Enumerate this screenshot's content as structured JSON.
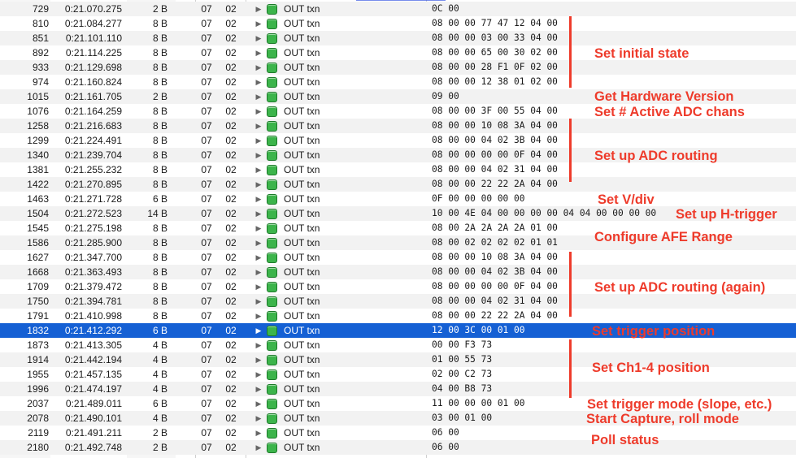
{
  "packets": [
    {
      "index": "729",
      "time": "0:21.070.275",
      "length": "2 B",
      "device": "07",
      "endpoint": "02",
      "description": "OUT txn",
      "data": "0C 00"
    },
    {
      "index": "810",
      "time": "0:21.084.277",
      "length": "8 B",
      "device": "07",
      "endpoint": "02",
      "description": "OUT txn",
      "data": "08 00 00 77 47 12 04 00"
    },
    {
      "index": "851",
      "time": "0:21.101.110",
      "length": "8 B",
      "device": "07",
      "endpoint": "02",
      "description": "OUT txn",
      "data": "08 00 00 03 00 33 04 00"
    },
    {
      "index": "892",
      "time": "0:21.114.225",
      "length": "8 B",
      "device": "07",
      "endpoint": "02",
      "description": "OUT txn",
      "data": "08 00 00 65 00 30 02 00"
    },
    {
      "index": "933",
      "time": "0:21.129.698",
      "length": "8 B",
      "device": "07",
      "endpoint": "02",
      "description": "OUT txn",
      "data": "08 00 00 28 F1 0F 02 00"
    },
    {
      "index": "974",
      "time": "0:21.160.824",
      "length": "8 B",
      "device": "07",
      "endpoint": "02",
      "description": "OUT txn",
      "data": "08 00 00 12 38 01 02 00"
    },
    {
      "index": "1015",
      "time": "0:21.161.705",
      "length": "2 B",
      "device": "07",
      "endpoint": "02",
      "description": "OUT txn",
      "data": "09 00"
    },
    {
      "index": "1076",
      "time": "0:21.164.259",
      "length": "8 B",
      "device": "07",
      "endpoint": "02",
      "description": "OUT txn",
      "data": "08 00 00 3F 00 55 04 00"
    },
    {
      "index": "1258",
      "time": "0:21.216.683",
      "length": "8 B",
      "device": "07",
      "endpoint": "02",
      "description": "OUT txn",
      "data": "08 00 00 10 08 3A 04 00"
    },
    {
      "index": "1299",
      "time": "0:21.224.491",
      "length": "8 B",
      "device": "07",
      "endpoint": "02",
      "description": "OUT txn",
      "data": "08 00 00 04 02 3B 04 00"
    },
    {
      "index": "1340",
      "time": "0:21.239.704",
      "length": "8 B",
      "device": "07",
      "endpoint": "02",
      "description": "OUT txn",
      "data": "08 00 00 00 00 0F 04 00"
    },
    {
      "index": "1381",
      "time": "0:21.255.232",
      "length": "8 B",
      "device": "07",
      "endpoint": "02",
      "description": "OUT txn",
      "data": "08 00 00 04 02 31 04 00"
    },
    {
      "index": "1422",
      "time": "0:21.270.895",
      "length": "8 B",
      "device": "07",
      "endpoint": "02",
      "description": "OUT txn",
      "data": "08 00 00 22 22 2A 04 00"
    },
    {
      "index": "1463",
      "time": "0:21.271.728",
      "length": "6 B",
      "device": "07",
      "endpoint": "02",
      "description": "OUT txn",
      "data": "0F 00 00 00 00 00"
    },
    {
      "index": "1504",
      "time": "0:21.272.523",
      "length": "14 B",
      "device": "07",
      "endpoint": "02",
      "description": "OUT txn",
      "data": "10 00 4E 04 00 00 00 00 04 04 00 00 00 00"
    },
    {
      "index": "1545",
      "time": "0:21.275.198",
      "length": "8 B",
      "device": "07",
      "endpoint": "02",
      "description": "OUT txn",
      "data": "08 00 2A 2A 2A 2A 01 00"
    },
    {
      "index": "1586",
      "time": "0:21.285.900",
      "length": "8 B",
      "device": "07",
      "endpoint": "02",
      "description": "OUT txn",
      "data": "08 00 02 02 02 02 01 01"
    },
    {
      "index": "1627",
      "time": "0:21.347.700",
      "length": "8 B",
      "device": "07",
      "endpoint": "02",
      "description": "OUT txn",
      "data": "08 00 00 10 08 3A 04 00"
    },
    {
      "index": "1668",
      "time": "0:21.363.493",
      "length": "8 B",
      "device": "07",
      "endpoint": "02",
      "description": "OUT txn",
      "data": "08 00 00 04 02 3B 04 00"
    },
    {
      "index": "1709",
      "time": "0:21.379.472",
      "length": "8 B",
      "device": "07",
      "endpoint": "02",
      "description": "OUT txn",
      "data": "08 00 00 00 00 0F 04 00"
    },
    {
      "index": "1750",
      "time": "0:21.394.781",
      "length": "8 B",
      "device": "07",
      "endpoint": "02",
      "description": "OUT txn",
      "data": "08 00 00 04 02 31 04 00"
    },
    {
      "index": "1791",
      "time": "0:21.410.998",
      "length": "8 B",
      "device": "07",
      "endpoint": "02",
      "description": "OUT txn",
      "data": "08 00 00 22 22 2A 04 00"
    },
    {
      "index": "1832",
      "time": "0:21.412.292",
      "length": "6 B",
      "device": "07",
      "endpoint": "02",
      "description": "OUT txn",
      "data": "12 00 3C 00 01 00",
      "selected": true
    },
    {
      "index": "1873",
      "time": "0:21.413.305",
      "length": "4 B",
      "device": "07",
      "endpoint": "02",
      "description": "OUT txn",
      "data": "00 00 F3 73"
    },
    {
      "index": "1914",
      "time": "0:21.442.194",
      "length": "4 B",
      "device": "07",
      "endpoint": "02",
      "description": "OUT txn",
      "data": "01 00 55 73"
    },
    {
      "index": "1955",
      "time": "0:21.457.135",
      "length": "4 B",
      "device": "07",
      "endpoint": "02",
      "description": "OUT txn",
      "data": "02 00 C2 73"
    },
    {
      "index": "1996",
      "time": "0:21.474.197",
      "length": "4 B",
      "device": "07",
      "endpoint": "02",
      "description": "OUT txn",
      "data": "04 00 B8 73"
    },
    {
      "index": "2037",
      "time": "0:21.489.011",
      "length": "6 B",
      "device": "07",
      "endpoint": "02",
      "description": "OUT txn",
      "data": "11 00 00 00 01 00"
    },
    {
      "index": "2078",
      "time": "0:21.490.101",
      "length": "4 B",
      "device": "07",
      "endpoint": "02",
      "description": "OUT txn",
      "data": "03 00 01 00"
    },
    {
      "index": "2119",
      "time": "0:21.491.211",
      "length": "2 B",
      "device": "07",
      "endpoint": "02",
      "description": "OUT txn",
      "data": "06 00"
    },
    {
      "index": "2180",
      "time": "0:21.492.748",
      "length": "2 B",
      "device": "07",
      "endpoint": "02",
      "description": "OUT txn",
      "data": "06 00"
    }
  ],
  "annotations": [
    {
      "text": "Set initial state"
    },
    {
      "text": "Get Hardware Version"
    },
    {
      "text": "Set # Active ADC chans"
    },
    {
      "text": "Set up ADC routing"
    },
    {
      "text": "Set V/div"
    },
    {
      "text": "Set up H-trigger"
    },
    {
      "text": "Configure AFE Range"
    },
    {
      "text": "Set up ADC routing (again)"
    },
    {
      "text": "Set trigger position"
    },
    {
      "text": "Set Ch1-4 position"
    },
    {
      "text": "Set trigger mode (slope, etc.)"
    },
    {
      "text": "Start Capture, roll mode"
    },
    {
      "text": "Poll status"
    }
  ],
  "colors": {
    "annotation": "#ee3b2b",
    "selection": "#1560d4",
    "packet_icon": "#3cb44b"
  },
  "icons": {
    "expand": "disclosure-triangle-icon",
    "packet": "packet-icon"
  }
}
